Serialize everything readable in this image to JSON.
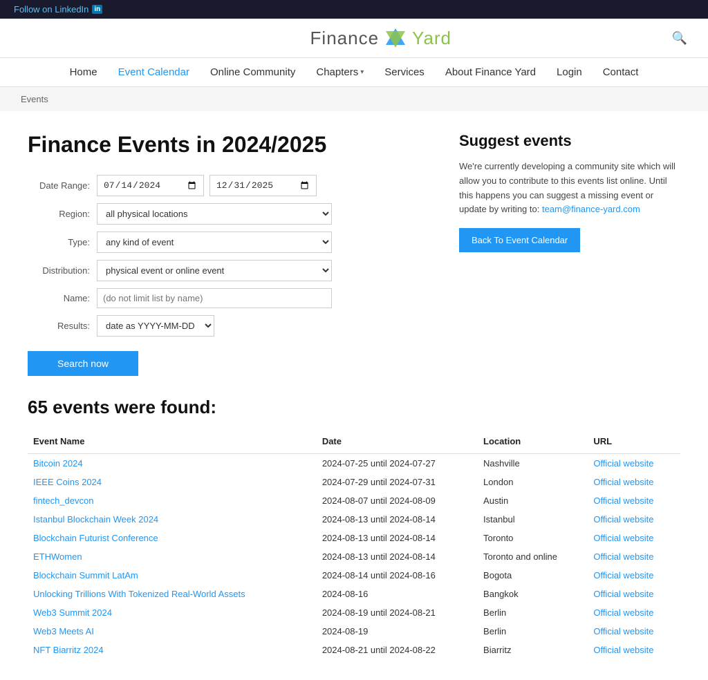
{
  "topbar": {
    "linkedin_text": "Follow on LinkedIn",
    "linkedin_icon": "in"
  },
  "header": {
    "logo_finance": "Finance",
    "logo_yard": "Yard",
    "search_aria": "Search"
  },
  "nav": {
    "items": [
      {
        "label": "Home",
        "active": false
      },
      {
        "label": "Event Calendar",
        "active": true
      },
      {
        "label": "Online Community",
        "active": false
      },
      {
        "label": "Chapters",
        "active": false,
        "dropdown": true
      },
      {
        "label": "Services",
        "active": false
      },
      {
        "label": "About Finance Yard",
        "active": false
      },
      {
        "label": "Login",
        "active": false
      },
      {
        "label": "Contact",
        "active": false
      }
    ]
  },
  "breadcrumb": "Events",
  "main": {
    "page_title": "Finance Events in 2024/2025",
    "form": {
      "date_range_label": "Date Range:",
      "date_from": "14.07.2024",
      "date_to": "31.12.2025",
      "region_label": "Region:",
      "region_value": "all physical locations",
      "type_label": "Type:",
      "type_value": "any kind of event",
      "distribution_label": "Distribution:",
      "distribution_value": "physical event or online event",
      "name_label": "Name:",
      "name_placeholder": "(do not limit list by name)",
      "results_label": "Results:",
      "results_value": "date as YYYY-MM-DD",
      "search_btn": "Search now"
    },
    "suggest": {
      "title": "Suggest events",
      "text": "We're currently developing a community site which will allow you to contribute to this events list online. Until this happens you can suggest a missing event or update by writing to:",
      "email": "team@finance-yard.com",
      "back_btn": "Back To Event Calendar"
    }
  },
  "results": {
    "count_text": "65 events were found:",
    "table": {
      "headers": [
        "Event Name",
        "Date",
        "Location",
        "URL"
      ],
      "rows": [
        {
          "name": "Bitcoin 2024",
          "date": "2024-07-25 until 2024-07-27",
          "location": "Nashville",
          "url": "Official website"
        },
        {
          "name": "IEEE Coins 2024",
          "date": "2024-07-29 until 2024-07-31",
          "location": "London",
          "url": "Official website"
        },
        {
          "name": "fintech_devcon",
          "date": "2024-08-07 until 2024-08-09",
          "location": "Austin",
          "url": "Official website"
        },
        {
          "name": "Istanbul Blockchain Week 2024",
          "date": "2024-08-13 until 2024-08-14",
          "location": "Istanbul",
          "url": "Official website"
        },
        {
          "name": "Blockchain Futurist Conference",
          "date": "2024-08-13 until 2024-08-14",
          "location": "Toronto",
          "url": "Official website"
        },
        {
          "name": "ETHWomen",
          "date": "2024-08-13 until 2024-08-14",
          "location": "Toronto and online",
          "url": "Official website"
        },
        {
          "name": "Blockchain Summit LatAm",
          "date": "2024-08-14 until 2024-08-16",
          "location": "Bogota",
          "url": "Official website"
        },
        {
          "name": "Unlocking Trillions With Tokenized Real-World Assets",
          "date": "2024-08-16",
          "location": "Bangkok",
          "url": "Official website"
        },
        {
          "name": "Web3 Summit 2024",
          "date": "2024-08-19 until 2024-08-21",
          "location": "Berlin",
          "url": "Official website"
        },
        {
          "name": "Web3 Meets AI",
          "date": "2024-08-19",
          "location": "Berlin",
          "url": "Official website"
        },
        {
          "name": "NFT Biarritz 2024",
          "date": "2024-08-21 until 2024-08-22",
          "location": "Biarritz",
          "url": "Official website"
        }
      ]
    }
  }
}
